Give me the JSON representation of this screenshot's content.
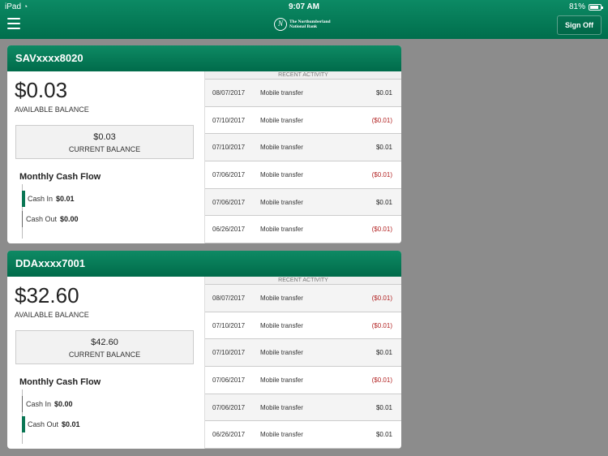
{
  "status_bar": {
    "device": "iPad",
    "time": "9:07 AM",
    "battery": "81%"
  },
  "header": {
    "logo_line1": "The Northumberland",
    "logo_line2": "National Bank",
    "sign_off_label": "Sign Off"
  },
  "recent_activity_label": "RECENT ACTIVITY",
  "accounts": [
    {
      "name": "SAVxxxx8020",
      "available_balance": "$0.03",
      "available_label": "AVAILABLE BALANCE",
      "current_balance": "$0.03",
      "current_label": "CURRENT BALANCE",
      "flow_title": "Monthly Cash Flow",
      "cash_in_label": "Cash In",
      "cash_in": "$0.01",
      "cash_out_label": "Cash Out",
      "cash_out": "$0.00",
      "transactions": [
        {
          "date": "08/07/2017",
          "desc": "Mobile transfer",
          "amount": "$0.01",
          "neg": false
        },
        {
          "date": "07/10/2017",
          "desc": "Mobile transfer",
          "amount": "($0.01)",
          "neg": true
        },
        {
          "date": "07/10/2017",
          "desc": "Mobile transfer",
          "amount": "$0.01",
          "neg": false
        },
        {
          "date": "07/06/2017",
          "desc": "Mobile transfer",
          "amount": "($0.01)",
          "neg": true
        },
        {
          "date": "07/06/2017",
          "desc": "Mobile transfer",
          "amount": "$0.01",
          "neg": false
        },
        {
          "date": "06/26/2017",
          "desc": "Mobile transfer",
          "amount": "($0.01)",
          "neg": true
        }
      ]
    },
    {
      "name": "DDAxxxx7001",
      "available_balance": "$32.60",
      "available_label": "AVAILABLE BALANCE",
      "current_balance": "$42.60",
      "current_label": "CURRENT BALANCE",
      "flow_title": "Monthly Cash Flow",
      "cash_in_label": "Cash In",
      "cash_in": "$0.00",
      "cash_out_label": "Cash Out",
      "cash_out": "$0.01",
      "transactions": [
        {
          "date": "08/07/2017",
          "desc": "Mobile transfer",
          "amount": "($0.01)",
          "neg": true
        },
        {
          "date": "07/10/2017",
          "desc": "Mobile transfer",
          "amount": "($0.01)",
          "neg": true
        },
        {
          "date": "07/10/2017",
          "desc": "Mobile transfer",
          "amount": "$0.01",
          "neg": false
        },
        {
          "date": "07/06/2017",
          "desc": "Mobile transfer",
          "amount": "($0.01)",
          "neg": true
        },
        {
          "date": "07/06/2017",
          "desc": "Mobile transfer",
          "amount": "$0.01",
          "neg": false
        },
        {
          "date": "06/26/2017",
          "desc": "Mobile transfer",
          "amount": "$0.01",
          "neg": false
        }
      ]
    }
  ]
}
